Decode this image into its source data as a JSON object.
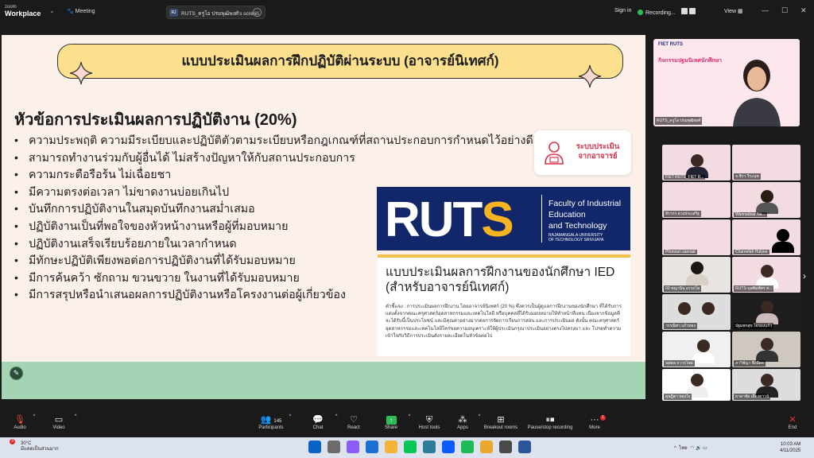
{
  "topbar": {
    "logo_small": "zoom",
    "logo_main": "Workplace",
    "meeting_label": "Meeting",
    "share_avatar": "RJ",
    "share_label": "RUTS_ครูโอ ปรมพุฒิพงศ์'s screen",
    "sign_in": "Sign in",
    "recording": "Recording...",
    "view": "View"
  },
  "slide": {
    "title": "แบบประเมินผลการฝึกปฏิบัติผ่านระบบ (อาจารย์นิเทศก์)",
    "heading": "หัวข้อการประเมินผลการปฏิบัติงาน (20%)",
    "bullets": [
      "ความประพฤติ ความมีระเบียบและปฏิบัติตัวตามระเบียบหรือกฎเกณฑ์ที่สถานประกอบการกำหนดไว้อย่างดี",
      "สามารถทำงานร่วมกับผู้อื่นได้ ไม่สร้างปัญหาให้กับสถานประกอบการ",
      "ความกระตือรือร้น ไม่เฉื่อยชา",
      "มีความตรงต่อเวลา ไม่ขาดงานบ่อยเกินไป",
      "บันทึกการปฏิบัติงานในสมุดบันทึกงานสม่ำเสมอ",
      "ปฏิบัติงานเป็นที่พอใจของหัวหน้างานหรือผู้ที่มอบหมาย",
      "ปฏิบัติงานเสร็จเรียบร้อยภายในเวลากำหนด",
      "มีทักษะปฏิบัติเพียงพอต่อการปฏิบัติงานที่ได้รับมอบหมาย",
      "มีการค้นคว้า ซักถาม ขวนขวาย ในงานที่ได้รับมอบหมาย",
      "มีการสรุปหรือนำเสนอผลการปฏิบัติงานหรือโครงงานต่อผู้เกี่ยวข้อง"
    ],
    "system_card": {
      "line1": "ระบบประเมิน",
      "line2": "จากอาจารย์"
    },
    "logo": {
      "word_a": "RUT",
      "word_b": "S",
      "faculty_1": "Faculty of Industrial",
      "faculty_2": "Education",
      "faculty_3": "and Technology",
      "uni_1": "RAJAMANGALA UNIVERSITY",
      "uni_2": "OF TECHNOLOGY SRIVIJAYA"
    },
    "doc": {
      "title_1": "แบบประเมินผลการฝึกงานของนักศึกษา IED",
      "title_2": "(สำหรับอาจารย์นิเทศก์)",
      "body": "คำชี้แจง : การประเมินผลการฝึกงาน โดยอาจารย์นิเทศก์ (20 %) ซึ่งควรเป็นผู้ดูแลการฝึกงานของนักศึกษา ที่ได้รับการแต่งตั้งจากคณะครุศาสตร์อุตสาหกรรมและเทคโนโลยี หรือบุคคลที่ได้รับมอบหมายให้ทำหน้าที่แทน เนื่องจากข้อมูลที่จะได้รับนี้เป็นประโยชน์ และมีคุณค่าอย่างมากต่อการจัดการเรียนการสอน และการประเมินผล ดังนั้น คณะครุศาสตร์อุตสาหกรรมและเทคโนโลยีใคร่ขอความอนุเคราะห์ให้ผู้ประเมินกรุณาประเมินอย่างตรงไปตรงมา และ โปรดทำความเข้าใจกับวิธีการประเมินดังรายละเอียดในหัวข้อต่อไป"
    }
  },
  "speaker": {
    "banner": "FIET RUTS",
    "banner_title": "กิจกรรมปฐมนิเทศนักศึกษา",
    "name": "RUTS_ครูโอ ปรมพุฒิพงศ์"
  },
  "participants": [
    {
      "name": "FIET RUTS_FIET R..."
    },
    {
      "name": "จ.ชิรา วีระนุช"
    },
    {
      "name": "สิรากร ดวงประเสริฐ"
    },
    {
      "name": "Wannadear Na..."
    },
    {
      "name": "Phonsan saeraat"
    },
    {
      "name": "Chareefah Hutyee"
    },
    {
      "name": "02-ชญานิน อรรถโพ"
    },
    {
      "name": "RUTS-บุพพิมพ์ทร ส..."
    },
    {
      "name": "วรรณิศา แก้วทอง"
    },
    {
      "name": "ปฐมพรสุข ใจของแก้ว"
    },
    {
      "name": "นพดล ถาวรไชย"
    },
    {
      "name": "ภาวิช์ญา พึงมีผล"
    },
    {
      "name": "ดุษฎิตา ทองใจ"
    },
    {
      "name": "ธาดาชัย เมืองดาวน์"
    }
  ],
  "toolbar": {
    "audio": "Audio",
    "video": "Video",
    "participants": "Participants",
    "participant_count": "145",
    "chat": "Chat",
    "react": "React",
    "share": "Share",
    "host_tools": "Host tools",
    "apps": "Apps",
    "breakout": "Breakout rooms",
    "pause_rec": "Pause/stop recording",
    "more": "More",
    "more_badge": "1",
    "end": "End"
  },
  "taskbar": {
    "temp": "30°C",
    "weather": "มีแดดเป็นส่วนมาก",
    "weather_badge": "3",
    "lang": "ไทย",
    "time": "10:03 AM",
    "date": "4/11/2025"
  },
  "colors": {
    "title_fill": "#fde08d",
    "slide_bg": "#fbf0ea",
    "green_strip": "#a4d4b4",
    "logo_navy": "#12276a",
    "logo_accent": "#f5b420",
    "zoom_green": "#2ebd59"
  }
}
